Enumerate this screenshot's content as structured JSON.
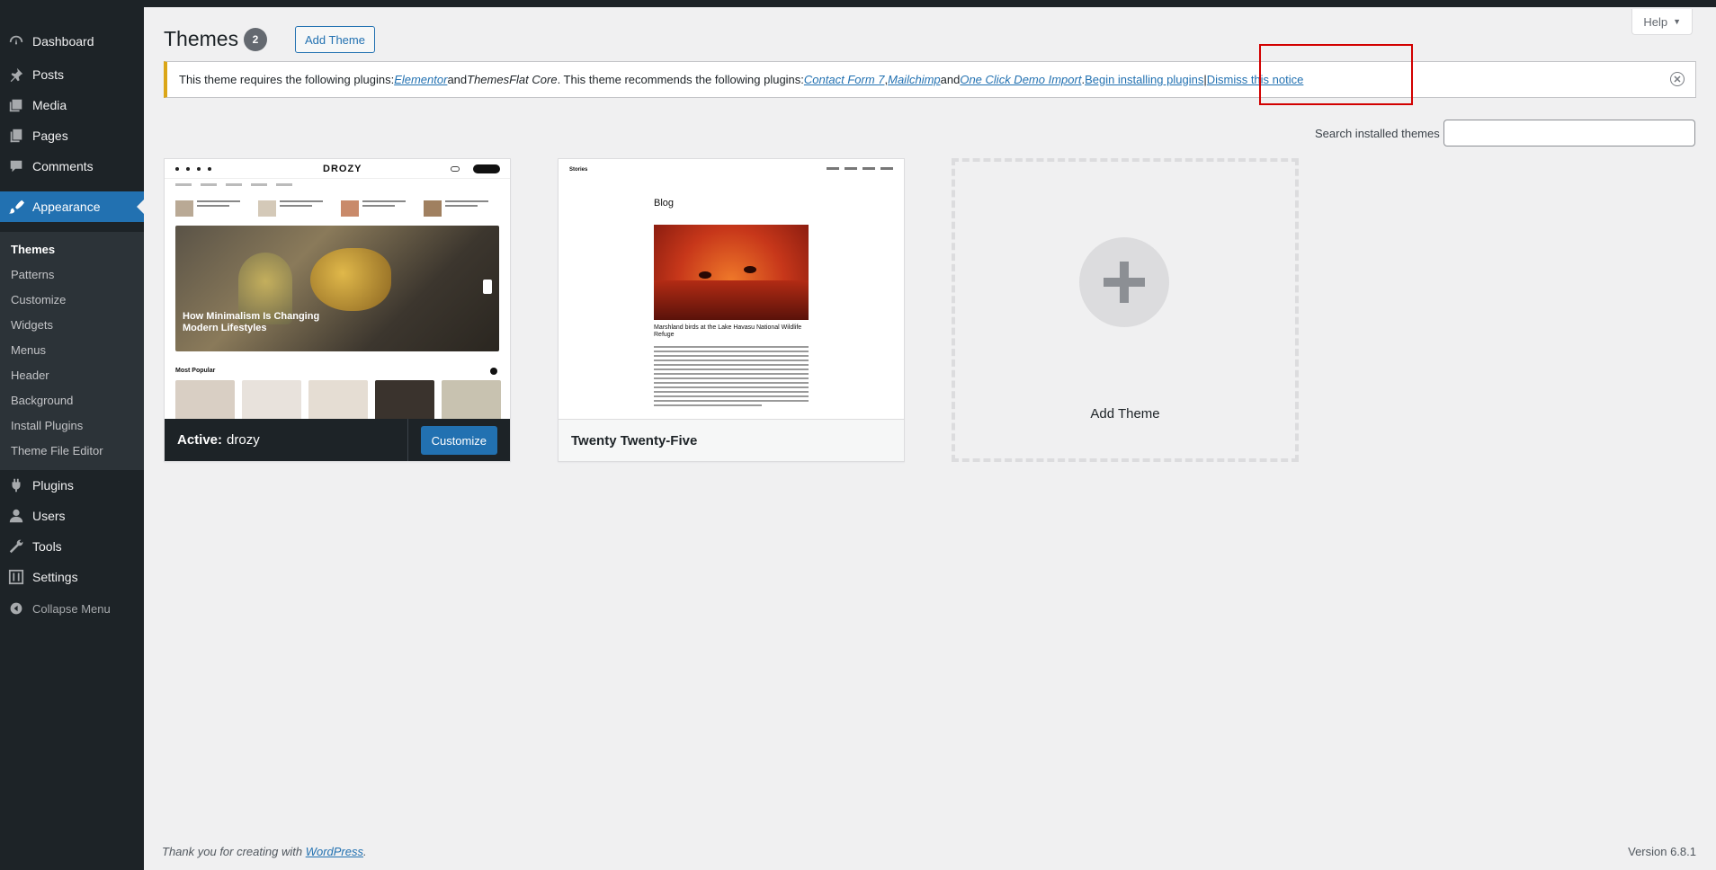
{
  "sidebar": {
    "items": [
      {
        "label": "Dashboard",
        "icon": "dashboard-icon"
      },
      {
        "label": "Posts",
        "icon": "pushpin-icon"
      },
      {
        "label": "Media",
        "icon": "media-icon"
      },
      {
        "label": "Pages",
        "icon": "pages-icon"
      },
      {
        "label": "Comments",
        "icon": "comment-icon"
      },
      {
        "label": "Appearance",
        "icon": "paintbrush-icon"
      },
      {
        "label": "Plugins",
        "icon": "plugin-icon"
      },
      {
        "label": "Users",
        "icon": "user-icon"
      },
      {
        "label": "Tools",
        "icon": "wrench-icon"
      },
      {
        "label": "Settings",
        "icon": "settings-icon"
      }
    ],
    "appearance_submenu": [
      "Themes",
      "Patterns",
      "Customize",
      "Widgets",
      "Menus",
      "Header",
      "Background",
      "Install Plugins",
      "Theme File Editor"
    ],
    "collapse_label": "Collapse Menu"
  },
  "header": {
    "title": "Themes",
    "count": "2",
    "add_theme_label": "Add Theme",
    "help_label": "Help"
  },
  "notice": {
    "text_1": "This theme requires the following plugins: ",
    "link_elementor": "Elementor",
    "text_2": " and ",
    "themesflat": "ThemesFlat Core",
    "text_3": ". This theme recommends the following plugins: ",
    "link_cf7": "Contact Form 7",
    "comma": ", ",
    "link_mailchimp": "Mailchimp",
    "text_4": " and ",
    "link_ocdi": "One Click Demo Import",
    "dot": ". ",
    "link_begin": "Begin installing plugins",
    "sep": " | ",
    "link_dismiss": "Dismiss this notice"
  },
  "search": {
    "label": "Search installed themes",
    "value": ""
  },
  "themes": {
    "active_prefix": "Active:",
    "active_name": "drozy",
    "customize_label": "Customize",
    "second_name": "Twenty Twenty-Five",
    "add_label": "Add Theme"
  },
  "drozy_preview": {
    "logo": "DROZY",
    "hero_title": "How Minimalism Is Changing Modern Lifestyles",
    "popular": "Most Popular"
  },
  "tt5_preview": {
    "site": "Stories",
    "heading": "Blog",
    "caption": "Marshland birds at the Lake Havasu National Wildlife Refuge"
  },
  "footer": {
    "thanks_prefix": "Thank you for creating with ",
    "wordpress_link": "WordPress",
    "thanks_suffix": ".",
    "version": "Version 6.8.1"
  },
  "colors": {
    "accent": "#2271b1",
    "sidebar_bg": "#1d2327",
    "notice_border": "#dba617",
    "highlight_box": "#d20000"
  }
}
